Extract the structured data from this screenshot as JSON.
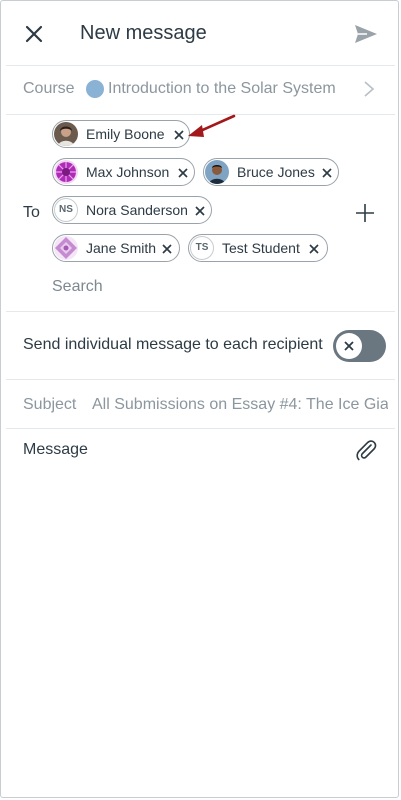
{
  "header": {
    "title": "New message",
    "close_icon": "close-icon",
    "send_icon": "send-icon"
  },
  "course": {
    "label": "Course",
    "value": "Introduction to the Solar System",
    "dot_color": "#8ab2d4"
  },
  "recipients": {
    "label": "To",
    "chips": [
      {
        "name": "Emily Boone",
        "avatar": "photo"
      },
      {
        "name": "Max Johnson",
        "avatar": "pattern-purple"
      },
      {
        "name": "Bruce Jones",
        "avatar": "photo"
      },
      {
        "name": "Nora Sanderson",
        "initials": "NS"
      },
      {
        "name": "Jane Smith",
        "avatar": "pattern-lilac"
      },
      {
        "name": "Test Student",
        "initials": "TS"
      }
    ],
    "search_placeholder": "Search"
  },
  "individual": {
    "label": "Send individual message to each recipient",
    "toggle_on": false
  },
  "subject": {
    "label": "Subject",
    "value": "All Submissions on Essay #4: The Ice Gia"
  },
  "message": {
    "label": "Message"
  },
  "colors": {
    "text": "#2d3b45",
    "muted": "#8b969e",
    "toggle_off": "#6b7780",
    "annotation_arrow": "#a3181a"
  }
}
